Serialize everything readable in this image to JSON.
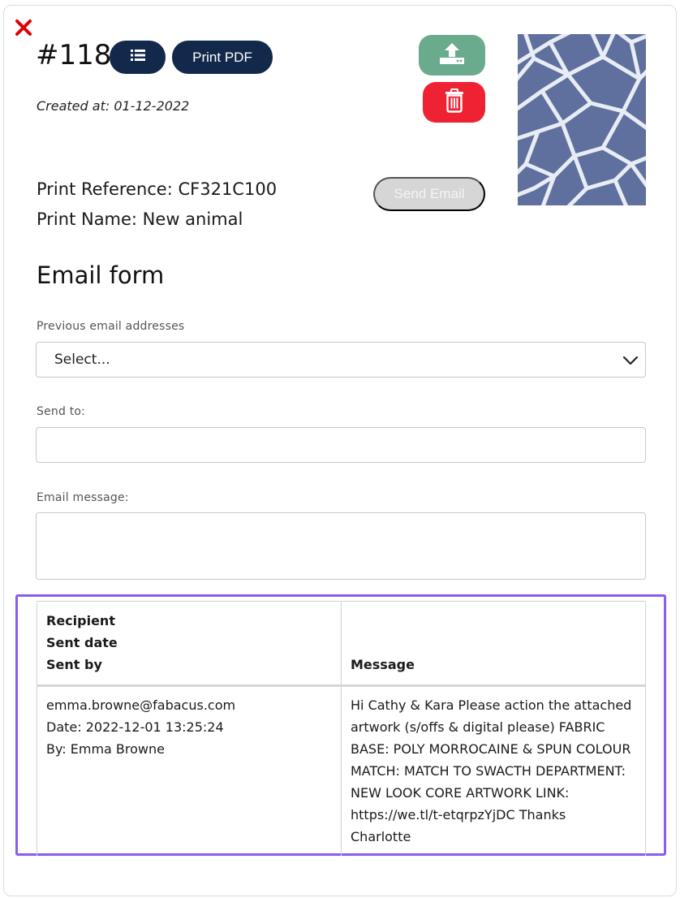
{
  "header": {
    "order_number": "#118",
    "print_pdf_label": "Print PDF",
    "created_at": "Created at: 01-12-2022",
    "print_reference": "Print Reference: CF321C100",
    "print_name": "Print Name: New animal",
    "send_email_label": "Send Email"
  },
  "icons": {
    "close": "close-icon",
    "list": "list-icon",
    "upload": "upload-icon",
    "delete": "trash-icon",
    "dropdown": "chevron-down-icon"
  },
  "colors": {
    "primary_dark": "#13294b",
    "upload_green": "#6aab8e",
    "delete_red": "#ee2233",
    "close_red": "#e00000",
    "highlight_purple": "#8a5cf0",
    "disabled_gray": "#d6d6d6"
  },
  "email_form": {
    "title": "Email form",
    "previous_label": "Previous email addresses",
    "previous_selected": "Select...",
    "send_to_label": "Send to:",
    "send_to_value": "",
    "message_label": "Email message:",
    "message_value": ""
  },
  "history_table": {
    "headers": {
      "recipient": "Recipient",
      "sent_date": "Sent date",
      "sent_by": "Sent by",
      "message": "Message"
    },
    "rows": [
      {
        "recipient": "emma.browne@fabacus.com",
        "date": "Date: 2022-12-01 13:25:24",
        "by": "By: Emma Browne",
        "message": "Hi Cathy & Kara Please action the attached\nartwork (s/offs & digital please) FABRIC\nBASE: POLY MORROCAINE & SPUN COLOUR\nMATCH: MATCH TO SWACTH DEPARTMENT:\nNEW LOOK CORE ARTWORK LINK:\nhttps://we.tl/t-etqrpzYjDC Thanks\nCharlotte"
      }
    ]
  }
}
